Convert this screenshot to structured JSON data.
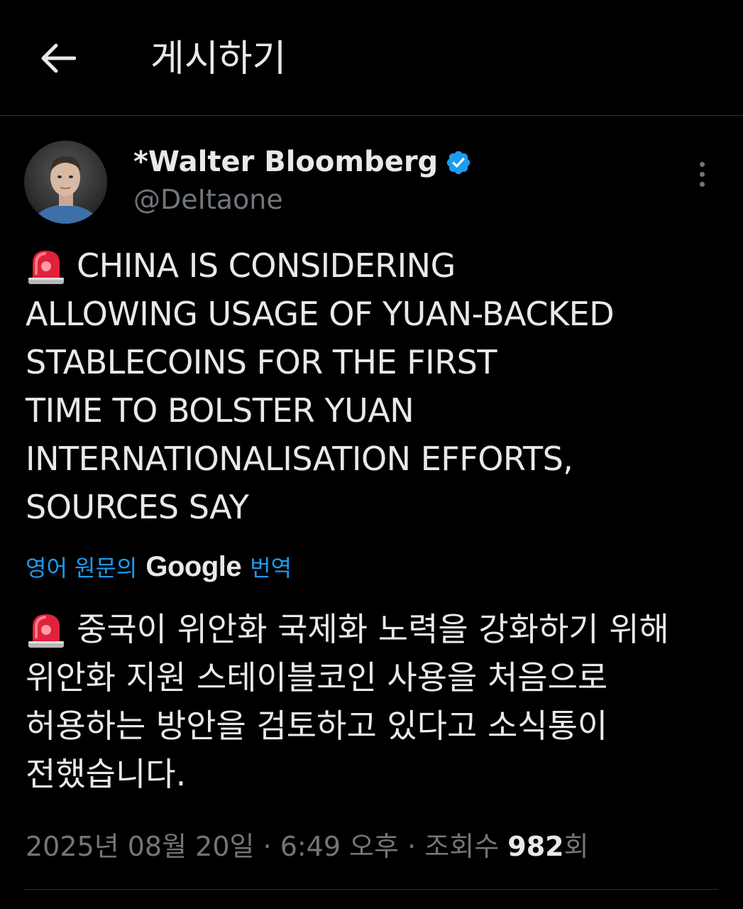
{
  "header": {
    "title": "게시하기"
  },
  "author": {
    "name": "*Walter Bloomberg",
    "handle": "@DeItaone",
    "verified": true,
    "badge_color": "#1d9bf0"
  },
  "tweet": {
    "lines": [
      "CHINA IS CONSIDERING",
      "ALLOWING USAGE OF YUAN-BACKED",
      "STABLECOINS FOR THE FIRST",
      "TIME TO BOLSTER YUAN",
      "INTERNATIONALISATION EFFORTS,",
      "SOURCES SAY"
    ],
    "leading_emoji": "siren-icon"
  },
  "translation": {
    "source_label": "영어 원문의",
    "brand": "Google",
    "action_label": "번역",
    "link_color": "#1d9bf0",
    "lines": [
      "중국이 위안화 국제화 노력을 강화하기 위해",
      "위안화 지원 스테이블코인 사용을 처음으로",
      "허용하는 방안을 검토하고 있다고 소식통이",
      "전했습니다."
    ]
  },
  "meta": {
    "date": "2025년 08월 20일",
    "separator": " · ",
    "time": "6:49 오후",
    "views_label": "조회수",
    "views_count": "982",
    "views_suffix": "회"
  }
}
